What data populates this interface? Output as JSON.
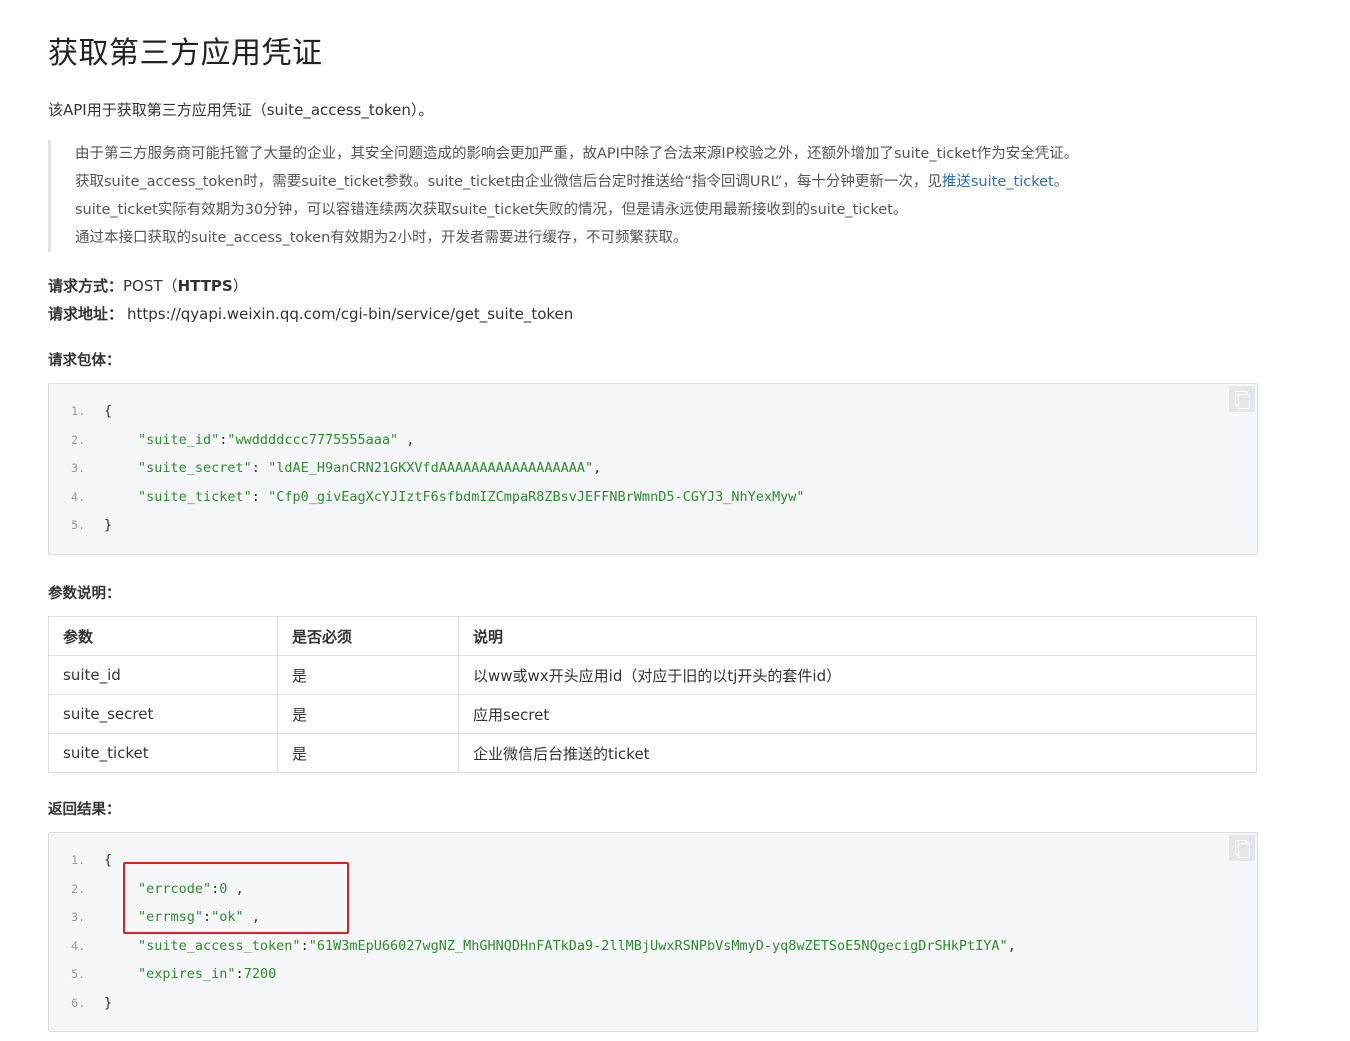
{
  "title": "获取第三方应用凭证",
  "intro": "该API用于获取第三方应用凭证（suite_access_token）。",
  "notes": {
    "line1": "由于第三方服务商可能托管了大量的企业，其安全问题造成的影响会更加严重，故API中除了合法来源IP校验之外，还额外增加了suite_ticket作为安全凭证。",
    "line2_pre": "获取suite_access_token时，需要suite_ticket参数。suite_ticket由企业微信后台定时推送给“指令回调URL”，每十分钟更新一次，见",
    "line2_link": "推送suite_ticket",
    "line2_post": "。",
    "line3": "suite_ticket实际有效期为30分钟，可以容错连续两次获取suite_ticket失败的情况，但是请永远使用最新接收到的suite_ticket。",
    "line4": "通过本接口获取的suite_access_token有效期为2小时，开发者需要进行缓存，不可频繁获取。"
  },
  "request": {
    "method_label": "请求方式：",
    "method_value": "POST（",
    "method_proto": "HTTPS",
    "method_close": "）",
    "url_label": "请求地址：",
    "url_value": "https://qyapi.weixin.qq.com/cgi-bin/service/get_suite_token"
  },
  "body_title": "请求包体：",
  "request_code": {
    "lines": [
      {
        "n": "1.",
        "open": "{"
      },
      {
        "n": "2.",
        "key": "\"suite_id\"",
        "sep": ":",
        "val": "\"wwddddccc7775555aaa\"",
        "tail": " ,"
      },
      {
        "n": "3.",
        "key": "\"suite_secret\"",
        "sep": ": ",
        "val": "\"ldAE_H9anCRN21GKXVfdAAAAAAAAAAAAAAAAAA\"",
        "tail": ","
      },
      {
        "n": "4.",
        "key": "\"suite_ticket\"",
        "sep": ": ",
        "val": "\"Cfp0_givEagXcYJIztF6sfbdmIZCmpaR8ZBsvJEFFNBrWmnD5-CGYJ3_NhYexMyw\"",
        "tail": ""
      },
      {
        "n": "5.",
        "open": "}"
      }
    ]
  },
  "params_title": "参数说明：",
  "params_table": {
    "headers": [
      "参数",
      "是否必须",
      "说明"
    ],
    "rows": [
      [
        "suite_id",
        "是",
        "以ww或wx开头应用id（对应于旧的以tj开头的套件id）"
      ],
      [
        "suite_secret",
        "是",
        "应用secret"
      ],
      [
        "suite_ticket",
        "是",
        "企业微信后台推送的ticket"
      ]
    ]
  },
  "result_title": "返回结果：",
  "response_code": {
    "lines": [
      {
        "n": "1.",
        "open": "{"
      },
      {
        "n": "2.",
        "key": "\"errcode\"",
        "sep": ":",
        "val": "0",
        "tail": " ,"
      },
      {
        "n": "3.",
        "key": "\"errmsg\"",
        "sep": ":",
        "val": "\"ok\"",
        "tail": " ,"
      },
      {
        "n": "4.",
        "key": "\"suite_access_token\"",
        "sep": ":",
        "val": "\"61W3mEpU66027wgNZ_MhGHNQDHnFATkDa9-2llMBjUwxRSNPbVsMmyD-yq8wZETSoE5NQgecigDrSHkPtIYA\"",
        "tail": ","
      },
      {
        "n": "5.",
        "key": "\"expires_in\"",
        "sep": ":",
        "val": "7200",
        "tail": ""
      },
      {
        "n": "6.",
        "open": "}"
      }
    ]
  },
  "icons": {
    "copy": "copy-icon"
  },
  "colors": {
    "link": "#2b6fb3",
    "string": "#2e8b2e",
    "highlight_border": "#e02020"
  }
}
